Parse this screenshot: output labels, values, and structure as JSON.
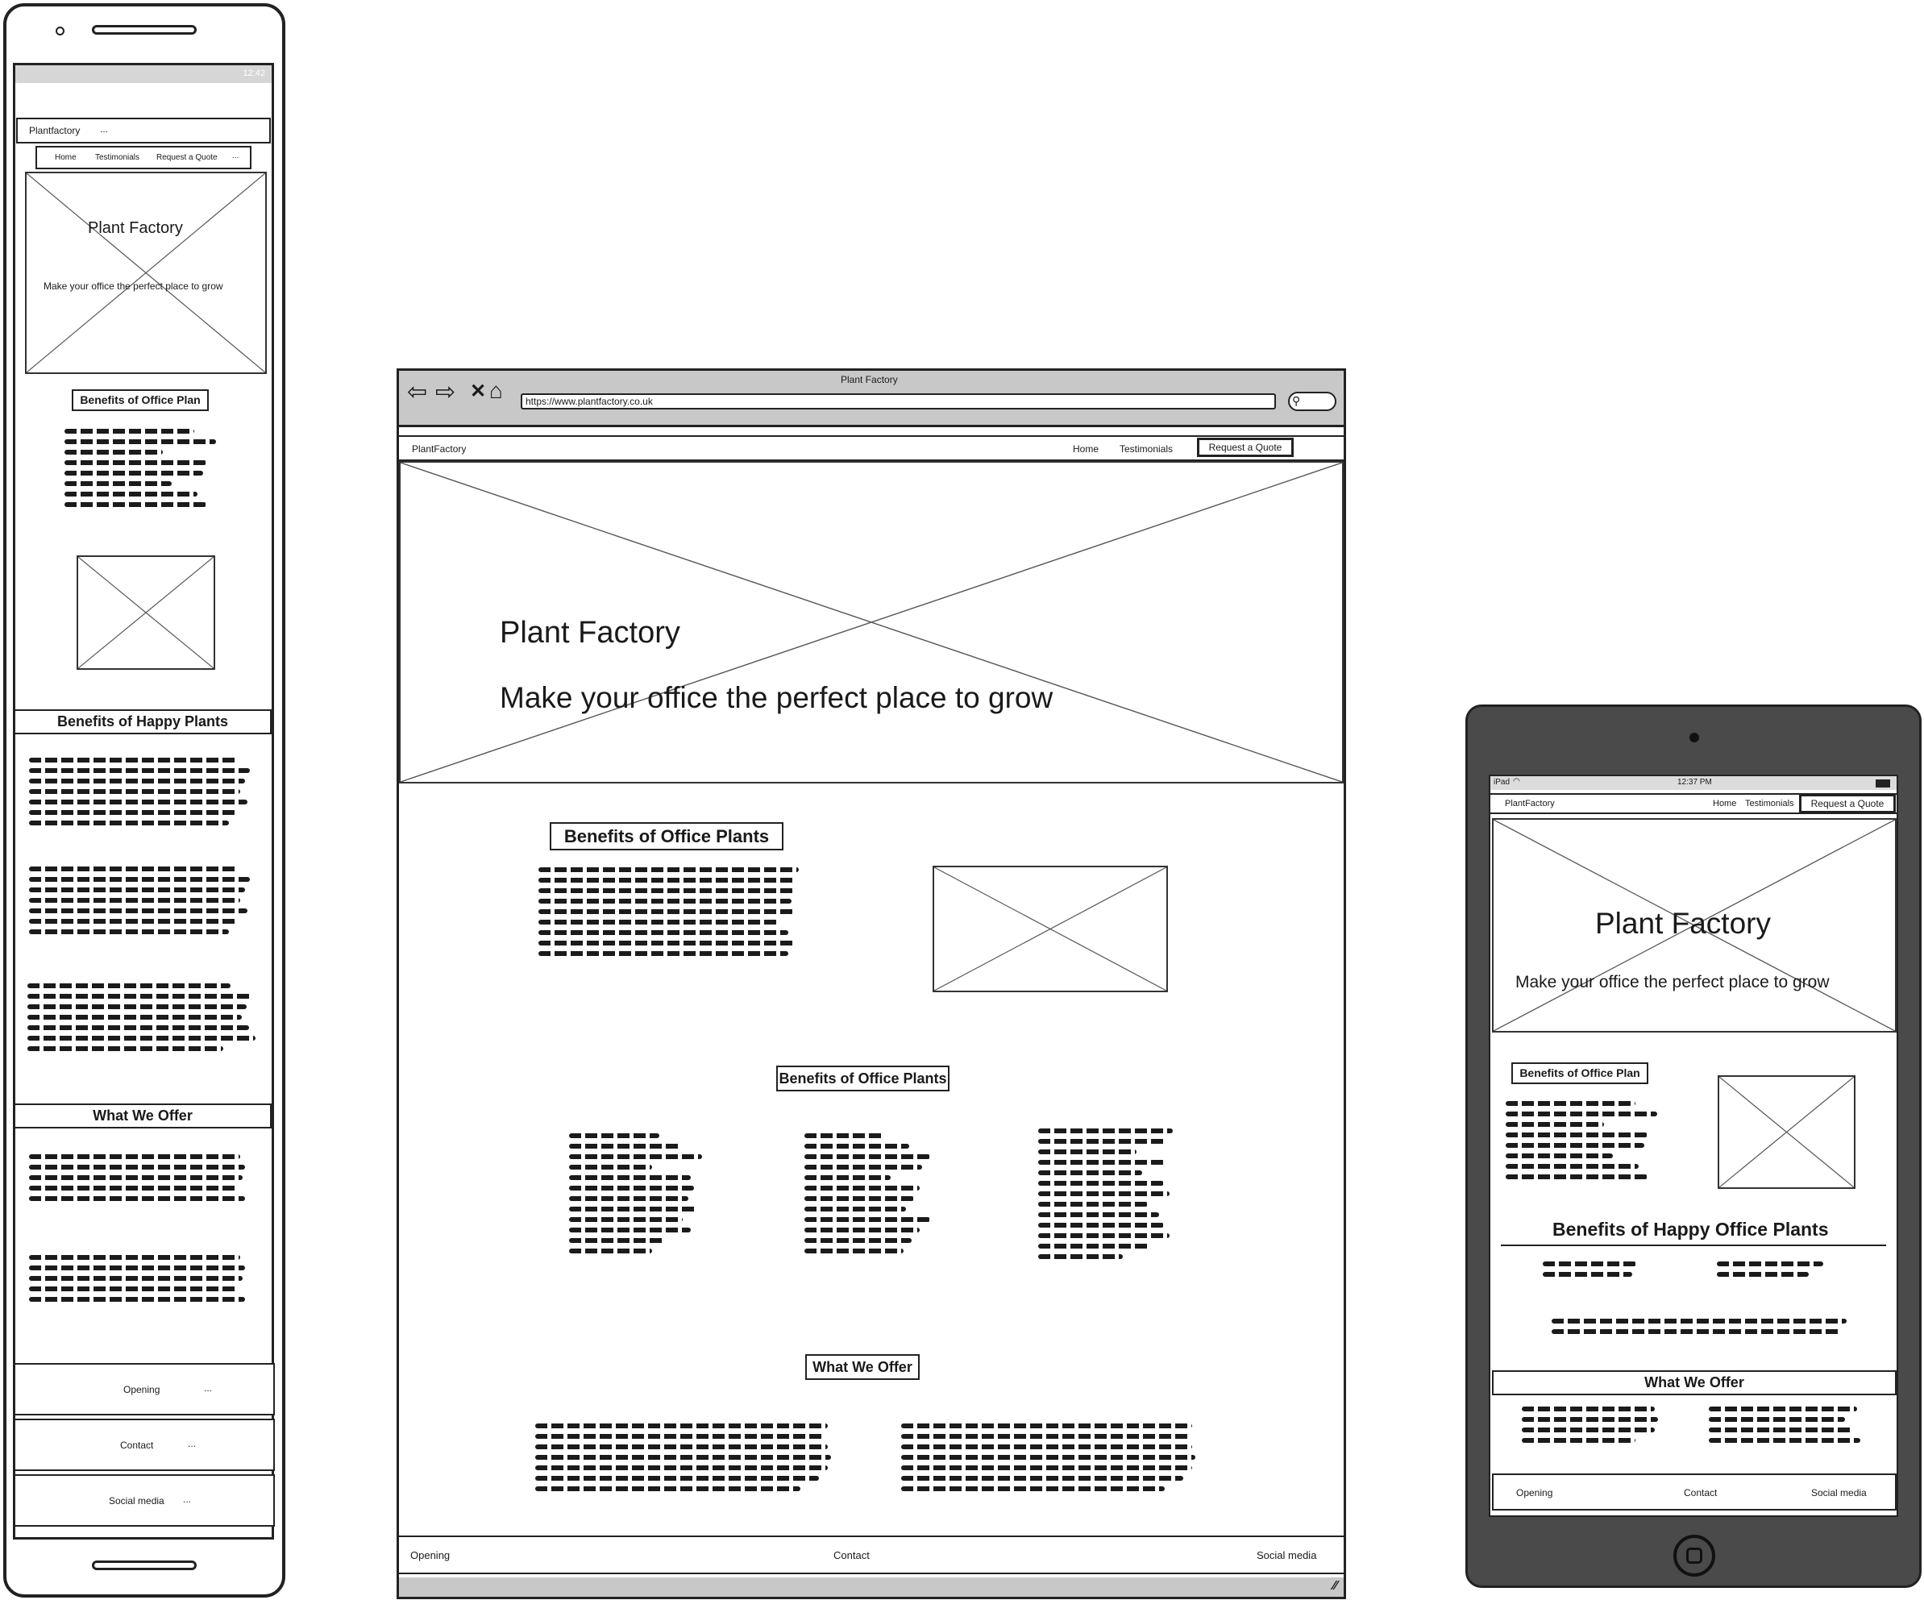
{
  "phone": {
    "status_time": "12:42",
    "brand": "Plantfactory",
    "brand_dots": "...",
    "nav": [
      "Home",
      "Testimonials",
      "Request a Quote"
    ],
    "nav_dots": "...",
    "hero_title": "Plant Factory",
    "hero_subtitle": "Make your office the perfect place to grow",
    "section1_title": "Benefits of Office Plan",
    "section2_title": "Benefits of Happy Plants",
    "section3_title": "What We Offer",
    "footer": [
      {
        "label": "Opening",
        "dots": "..."
      },
      {
        "label": "Contact",
        "dots": "..."
      },
      {
        "label": "Social media",
        "dots": "..."
      }
    ]
  },
  "browser": {
    "window_title": "Plant Factory",
    "url": "https://www.plantfactory.co.uk",
    "brand": "PlantFactory",
    "nav": [
      "Home",
      "Testimonials"
    ],
    "cta": "Request a Quote",
    "hero_title": "Plant Factory",
    "hero_subtitle": "Make your office the perfect place to grow",
    "section1_title": "Benefits of Office Plants",
    "section2_title": "Benefits of Office Plants",
    "section3_title": "What We Offer",
    "footer": [
      "Opening",
      "Contact",
      "Social media"
    ]
  },
  "tablet": {
    "status_device": "iPad",
    "status_time": "12:37 PM",
    "brand": "PlantFactory",
    "nav": [
      "Home",
      "Testimonials"
    ],
    "cta": "Request a Quote",
    "hero_title": "Plant Factory",
    "hero_subtitle": "Make your office the perfect place to grow",
    "section1_title": "Benefits of Office Plan",
    "section2_title": "Benefits of Happy Office Plants",
    "section3_title": "What We Offer",
    "footer": [
      "Opening",
      "Contact",
      "Social media"
    ]
  },
  "colors": {
    "frame": "#222222",
    "browser_chrome": "#c8c8c8",
    "tablet_body": "#4a4a4a",
    "placeholder_line": "#555555"
  }
}
